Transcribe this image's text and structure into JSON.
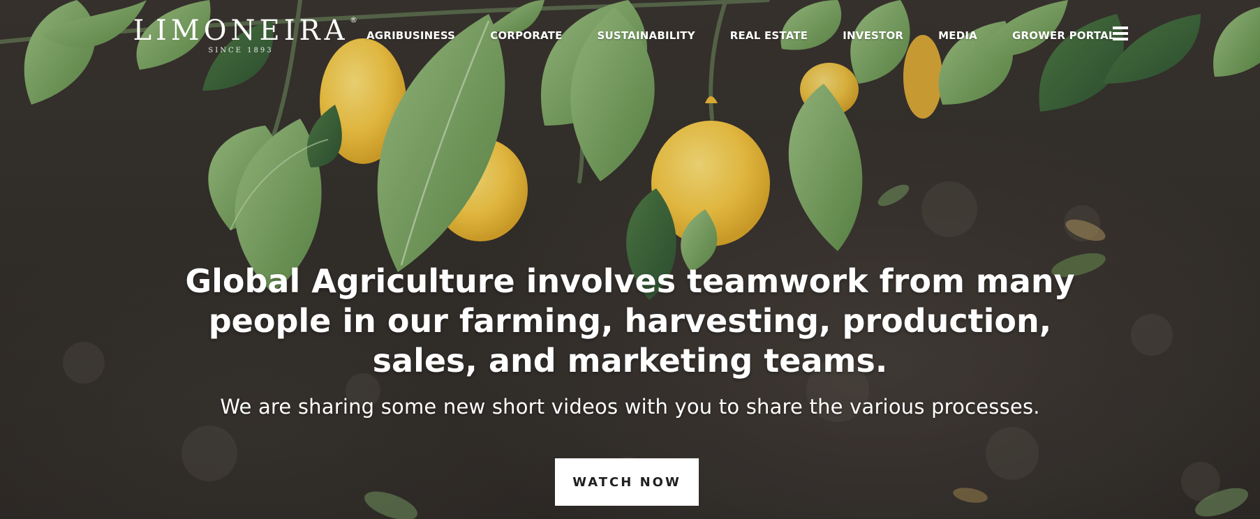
{
  "brand": {
    "logo_text": "LIMONEIRA",
    "registered_mark": "®",
    "since_text": "SINCE 1893"
  },
  "nav": {
    "items": [
      {
        "label": "AGRIBUSINESS"
      },
      {
        "label": "CORPORATE"
      },
      {
        "label": "SUSTAINABILITY"
      },
      {
        "label": "REAL ESTATE"
      },
      {
        "label": "INVESTOR"
      },
      {
        "label": "MEDIA"
      },
      {
        "label": "GROWER PORTAL"
      }
    ],
    "menu_icon": "hamburger-menu-icon"
  },
  "hero": {
    "headline": "Global Agriculture involves teamwork from many people in our farming, harvesting, production, sales, and marketing teams.",
    "subheadline": "We are sharing some new short videos with you to share the various processes.",
    "cta_label": "WATCH NOW"
  },
  "colors": {
    "text": "#ffffff",
    "cta_background": "#ffffff",
    "cta_text": "#1f1f1f",
    "soil": "#35302c",
    "leaf": "#6f9a55",
    "lemon": "#f3c444"
  }
}
